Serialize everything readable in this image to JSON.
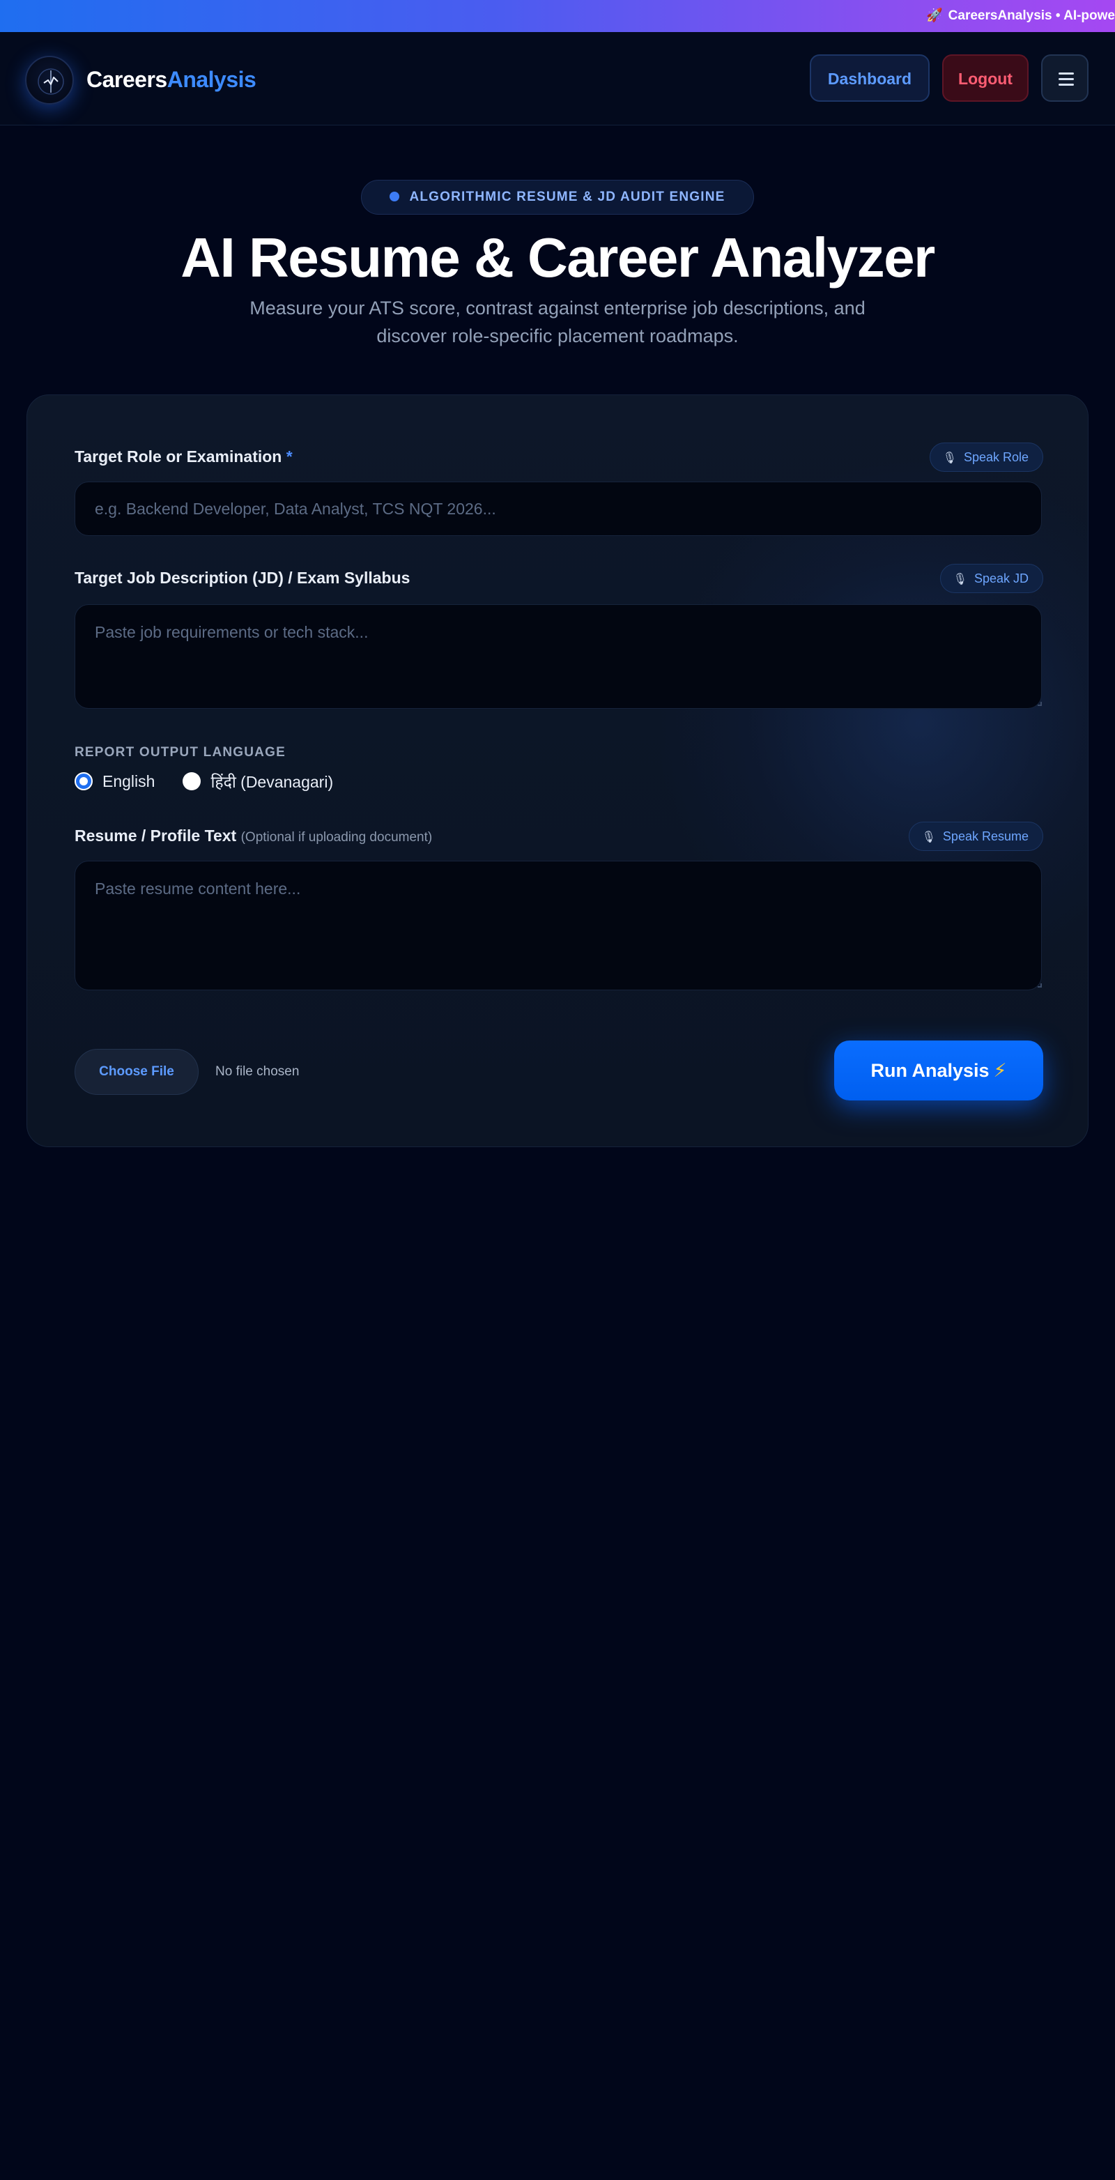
{
  "ticker": {
    "icon": "rocket-icon",
    "text": "CareersAnalysis • AI-powe"
  },
  "navbar": {
    "brand_primary": "Careers",
    "brand_accent": "Analysis",
    "dashboard_label": "Dashboard",
    "logout_label": "Logout",
    "menu_icon": "hamburger-menu-icon"
  },
  "hero": {
    "badge": "ALGORITHMIC RESUME & JD AUDIT ENGINE",
    "title": "AI Resume & Career Analyzer",
    "subtitle_line1": "Measure your ATS score, contrast against enterprise job descriptions, and",
    "subtitle_line2": "discover role-specific placement roadmaps."
  },
  "form": {
    "role": {
      "label": "Target Role or Examination",
      "required_mark": "*",
      "speak_label": "Speak Role",
      "placeholder": "e.g. Backend Developer, Data Analyst, TCS NQT 2026..."
    },
    "jd": {
      "label": "Target Job Description (JD) / Exam Syllabus",
      "speak_label": "Speak JD",
      "placeholder": "Paste job requirements or tech stack..."
    },
    "language": {
      "heading": "REPORT OUTPUT LANGUAGE",
      "options": [
        {
          "label": "English",
          "selected": true
        },
        {
          "label": "हिंदी (Devanagari)",
          "selected": false
        }
      ]
    },
    "resume": {
      "label": "Resume / Profile Text",
      "hint": "(Optional if uploading document)",
      "speak_label": "Speak Resume",
      "placeholder": "Paste resume content here..."
    },
    "file": {
      "button_label": "Choose File",
      "status": "No file chosen"
    },
    "submit_label": "Run Analysis"
  },
  "colors": {
    "background": "#01061a",
    "accent": "#3d8bff",
    "primary_button": "#0a6dff",
    "logout": "#ff5d73"
  }
}
